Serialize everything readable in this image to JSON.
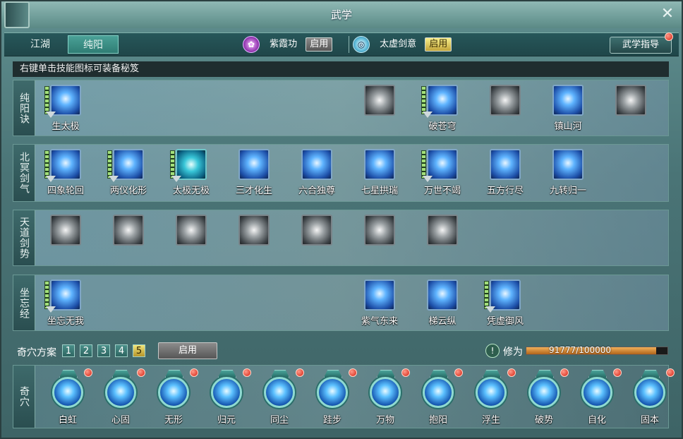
{
  "window": {
    "title": "武学"
  },
  "tabs": [
    {
      "label": "江湖",
      "active": false
    },
    {
      "label": "纯阳",
      "active": true
    }
  ],
  "gong": [
    {
      "name": "紫霞功",
      "status": "启用",
      "state": "off",
      "icon": "purple-lotus-icon"
    },
    {
      "name": "太虚剑意",
      "status": "启用",
      "state": "on",
      "icon": "sword-swirl-icon"
    }
  ],
  "guide_button": "武学指导",
  "hint": "右键单击技能图标可装备秘笈",
  "rows": [
    {
      "label": "纯阳诀",
      "skills": [
        {
          "name": "生太极",
          "icon": "taiji-icon",
          "style": "blue",
          "slot": 0,
          "bar": true
        },
        {
          "name": "",
          "icon": "burst-icon",
          "style": "gray",
          "slot": 5,
          "bar": false
        },
        {
          "name": "破苍穹",
          "icon": "blade-storm-icon",
          "style": "blue",
          "slot": 6,
          "bar": true
        },
        {
          "name": "",
          "icon": "whirl-icon",
          "style": "gray",
          "slot": 7,
          "bar": false
        },
        {
          "name": "镇山河",
          "icon": "meditate-icon",
          "style": "blue",
          "slot": 8,
          "bar": false
        },
        {
          "name": "",
          "icon": "dragon-icon",
          "style": "gray",
          "slot": 9,
          "bar": false
        }
      ]
    },
    {
      "label": "北冥剑气",
      "skills": [
        {
          "name": "四象轮回",
          "icon": "four-orb-icon",
          "style": "blue",
          "slot": 0,
          "bar": true
        },
        {
          "name": "两仪化形",
          "icon": "yin-yang-icon",
          "style": "blue",
          "slot": 1,
          "bar": true
        },
        {
          "name": "太极无极",
          "icon": "circle-swirl-icon",
          "style": "cyan",
          "slot": 2,
          "bar": true
        },
        {
          "name": "三才化生",
          "icon": "slash-icon",
          "style": "blue",
          "slot": 3,
          "bar": false
        },
        {
          "name": "六合独尊",
          "icon": "triple-slash-icon",
          "style": "blue",
          "slot": 4,
          "bar": false
        },
        {
          "name": "七星拱瑞",
          "icon": "star-burst-icon",
          "style": "blue",
          "slot": 5,
          "bar": false
        },
        {
          "name": "万世不竭",
          "icon": "vortex-icon",
          "style": "blue",
          "slot": 6,
          "bar": true
        },
        {
          "name": "五方行尽",
          "icon": "spikes-icon",
          "style": "blue",
          "slot": 7,
          "bar": false
        },
        {
          "name": "九转归一",
          "icon": "pillar-icon",
          "style": "blue",
          "slot": 8,
          "bar": false
        }
      ]
    },
    {
      "label": "天道剑势",
      "skills": [
        {
          "name": "",
          "icon": "streak-icon",
          "style": "gray",
          "slot": 0,
          "bar": false
        },
        {
          "name": "",
          "icon": "ray-icon",
          "style": "gray",
          "slot": 1,
          "bar": false
        },
        {
          "name": "",
          "icon": "beam-icon",
          "style": "gray",
          "slot": 2,
          "bar": false
        },
        {
          "name": "",
          "icon": "pillars-icon",
          "style": "gray",
          "slot": 3,
          "bar": false
        },
        {
          "name": "",
          "icon": "star-icon",
          "style": "gray",
          "slot": 4,
          "bar": false
        },
        {
          "name": "",
          "icon": "wind-icon",
          "style": "gray",
          "slot": 5,
          "bar": false
        },
        {
          "name": "",
          "icon": "step-icon",
          "style": "gray",
          "slot": 6,
          "bar": false
        }
      ]
    },
    {
      "label": "坐忘经",
      "skills": [
        {
          "name": "坐忘无我",
          "icon": "seated-monk-icon",
          "style": "blue",
          "slot": 0,
          "bar": true
        },
        {
          "name": "紫气东来",
          "icon": "wave-icon",
          "style": "blue",
          "slot": 5,
          "bar": false
        },
        {
          "name": "梯云纵",
          "icon": "leap-icon",
          "style": "blue",
          "slot": 6,
          "bar": false
        },
        {
          "name": "凭虚御风",
          "icon": "flying-icon",
          "style": "blue",
          "slot": 7,
          "bar": true
        }
      ]
    }
  ],
  "scheme": {
    "label": "奇穴方案",
    "numbers": [
      "1",
      "2",
      "3",
      "4",
      "5"
    ],
    "selected": "5",
    "apply": "启用"
  },
  "xiuwei": {
    "label": "修为",
    "value": "91777/100000",
    "fraction": 0.91777,
    "icon_text": "!"
  },
  "qixue": {
    "label": "奇穴",
    "items": [
      {
        "name": "白虹",
        "icon": "white-rainbow-icon"
      },
      {
        "name": "心固",
        "icon": "heart-shield-icon"
      },
      {
        "name": "无形",
        "icon": "formless-icon"
      },
      {
        "name": "归元",
        "icon": "return-orb-icon"
      },
      {
        "name": "同尘",
        "icon": "dust-icon"
      },
      {
        "name": "跬步",
        "icon": "footstep-icon"
      },
      {
        "name": "万物",
        "icon": "all-things-icon"
      },
      {
        "name": "抱阳",
        "icon": "embrace-sun-icon"
      },
      {
        "name": "浮生",
        "icon": "floating-life-icon"
      },
      {
        "name": "破势",
        "icon": "break-stance-icon"
      },
      {
        "name": "自化",
        "icon": "self-transform-icon"
      },
      {
        "name": "固本",
        "icon": "root-icon"
      }
    ]
  }
}
